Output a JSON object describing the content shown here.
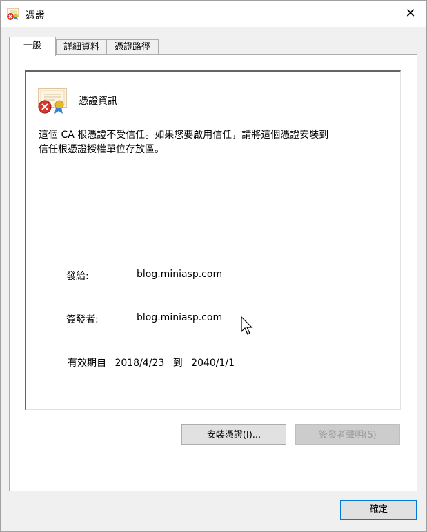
{
  "window": {
    "title": "憑證",
    "close_glyph": "✕"
  },
  "tabs": [
    {
      "label": "一般",
      "active": true
    },
    {
      "label": "詳細資料",
      "active": false
    },
    {
      "label": "憑證路徑",
      "active": false
    }
  ],
  "general": {
    "info_title": "憑證資訊",
    "message_line1": "這個 CA 根憑證不受信任。如果您要啟用信任，請將這個憑證安裝到",
    "message_line2": "信任根憑證授權單位存放區。",
    "issued_to_label": "發給:",
    "issued_to_value": "blog.miniasp.com",
    "issued_by_label": "簽發者:",
    "issued_by_value": "blog.miniasp.com",
    "valid_from_label": "有效期自",
    "valid_from_value": "2018/4/23",
    "valid_to_label": "到",
    "valid_to_value": "2040/1/1"
  },
  "buttons": {
    "install_label": "安裝憑證(I)...",
    "issuer_statement_label": "簽發者聲明(S)",
    "ok_label": "確定"
  },
  "icons": {
    "title_icon": "certificate-error-icon",
    "cert_icon": "certificate-error-icon"
  }
}
